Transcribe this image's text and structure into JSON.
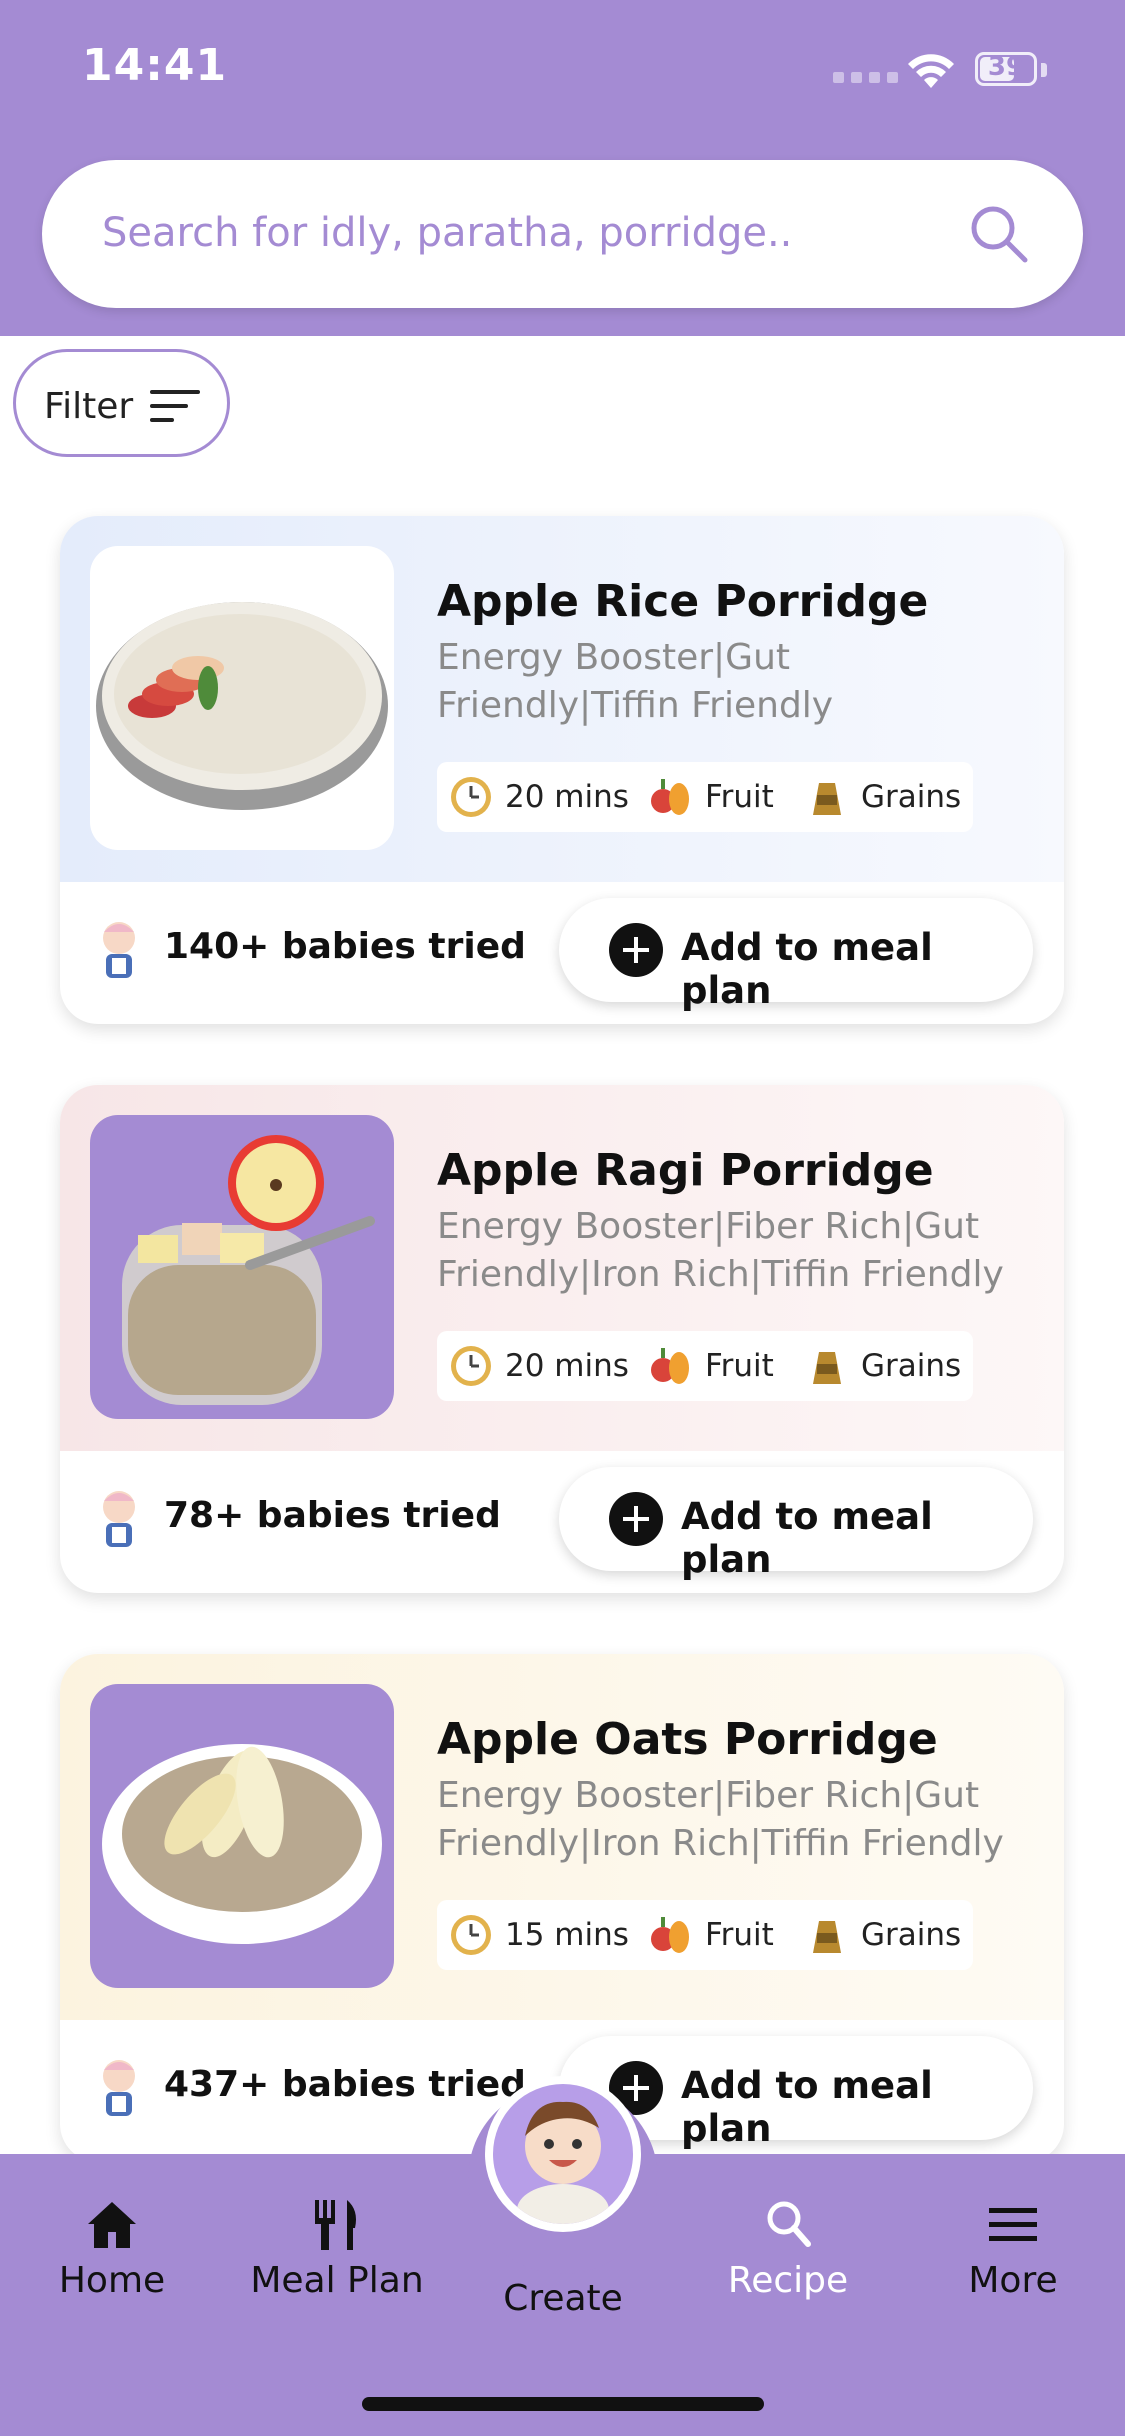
{
  "status_bar": {
    "time": "14:41",
    "battery": "39"
  },
  "search": {
    "placeholder": "Search for idly, paratha, porridge.."
  },
  "filter": {
    "label": "Filter"
  },
  "recipes": [
    {
      "title": "Apple Rice Porridge",
      "tags": "Energy Booster|Gut Friendly|Tiffin Friendly",
      "time": "20 mins",
      "category1": "Fruit",
      "category2": "Grains",
      "tried": "140+ babies tried",
      "add_label": "Add to meal plan",
      "tint": "#e9f0fb"
    },
    {
      "title": "Apple Ragi Porridge",
      "tags": "Energy Booster|Fiber Rich|Gut Friendly|Iron Rich|Tiffin Friendly",
      "time": "20 mins",
      "category1": "Fruit",
      "category2": "Grains",
      "tried": "78+ babies tried",
      "add_label": "Add to meal plan",
      "tint": "#f8e9ea"
    },
    {
      "title": "Apple Oats Porridge",
      "tags": "Energy Booster|Fiber Rich|Gut Friendly|Iron Rich|Tiffin Friendly",
      "time": "15 mins",
      "category1": "Fruit",
      "category2": "Grains",
      "tried": "437+ babies tried",
      "add_label": "Add to meal plan",
      "tint": "#fdf6e6"
    }
  ],
  "nav": {
    "items": [
      {
        "label": "Home",
        "icon": "home-icon"
      },
      {
        "label": "Meal Plan",
        "icon": "fork-knife-icon"
      },
      {
        "label": "Create",
        "icon": "baby-avatar-icon"
      },
      {
        "label": "Recipe",
        "icon": "search-icon"
      },
      {
        "label": "More",
        "icon": "menu-icon"
      }
    ],
    "active": "Recipe"
  },
  "colors": {
    "accent": "#a48bd3",
    "background": "#ffffff"
  }
}
